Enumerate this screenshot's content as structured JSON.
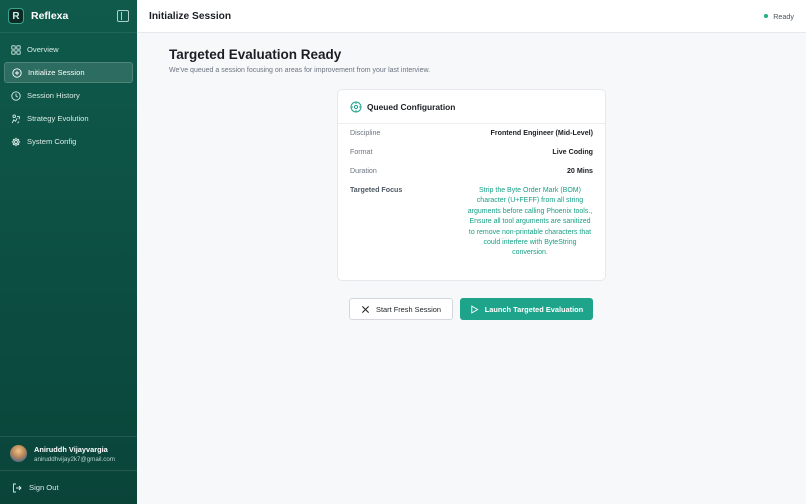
{
  "brand": {
    "logo_letter": "R",
    "name": "Reflexa"
  },
  "sidebar": {
    "items": [
      {
        "label": "Overview",
        "icon": "grid-icon",
        "active": false
      },
      {
        "label": "Initialize Session",
        "icon": "plus-circle-icon",
        "active": true
      },
      {
        "label": "Session History",
        "icon": "clock-icon",
        "active": false
      },
      {
        "label": "Strategy Evolution",
        "icon": "evolution-icon",
        "active": false
      },
      {
        "label": "System Config",
        "icon": "gear-icon",
        "active": false
      }
    ],
    "user": {
      "name": "Aniruddh Vijayvargia",
      "email": "aniruddhvijay2k7@gmail.com"
    },
    "signout_label": "Sign Out"
  },
  "header": {
    "title": "Initialize Session",
    "status": "Ready",
    "status_color": "#22b07d"
  },
  "main": {
    "headline": "Targeted Evaluation Ready",
    "subline": "We've queued a session focusing on areas for improvement from your last interview.",
    "card": {
      "title": "Queued Configuration",
      "discipline_label": "Discipline",
      "discipline_value": "Frontend Engineer (Mid-Level)",
      "format_label": "Format",
      "format_value": "Live Coding",
      "duration_label": "Duration",
      "duration_value": "20 Mins",
      "focus_label": "Targeted Focus",
      "focus_value": "Strip the Byte Order Mark (BOM) character (U+FEFF) from all string arguments before calling Phoenix tools., Ensure all tool arguments are sanitized to remove non-printable characters that could interfere with ByteString conversion."
    },
    "buttons": {
      "fresh": "Start Fresh Session",
      "launch": "Launch Targeted Evaluation"
    }
  },
  "colors": {
    "sidebar": "#0f5a4b",
    "accent": "#1fa48c",
    "focus_text": "#17a085"
  }
}
